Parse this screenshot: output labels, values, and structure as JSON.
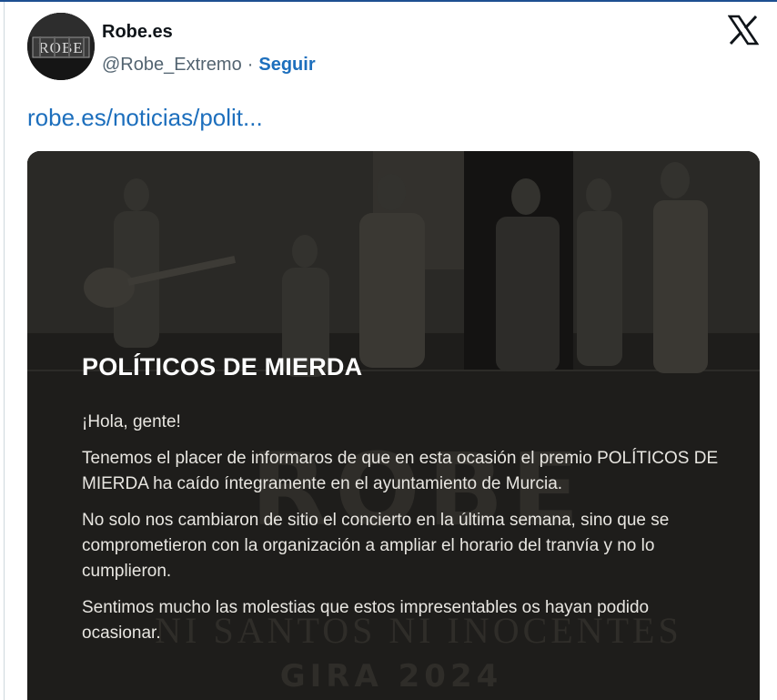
{
  "tweet": {
    "avatar_text": "ROBE",
    "display_name": "Robe.es",
    "handle": "@Robe_Extremo",
    "separator": "·",
    "follow_label": "Seguir",
    "link_text": "robe.es/noticias/polit..."
  },
  "card": {
    "bg_band_name": "ROBE",
    "bg_tour_line": "NI SANTOS NI INOCENTES",
    "bg_tour_year": "GIRA 2024",
    "title": "POLÍTICOS DE MIERDA",
    "paragraphs": [
      "¡Hola, gente!",
      "Tenemos el placer de informaros de que en esta ocasión el premio POLÍTICOS DE MIERDA ha caído íntegramente en el ayuntamiento de Murcia.",
      "No solo nos cambiaron de sitio el concierto en la última semana, sino que se comprometieron con la organización a ampliar el horario del tranvía y no lo cumplieron.",
      "Sentimos mucho las molestias que estos impresentables os hayan podido ocasionar."
    ]
  },
  "icons": {
    "brand": "x-logo-icon"
  },
  "colors": {
    "link": "#1d6fbd",
    "card_bg": "#1e1d1b",
    "top_line": "#1d4f91"
  }
}
